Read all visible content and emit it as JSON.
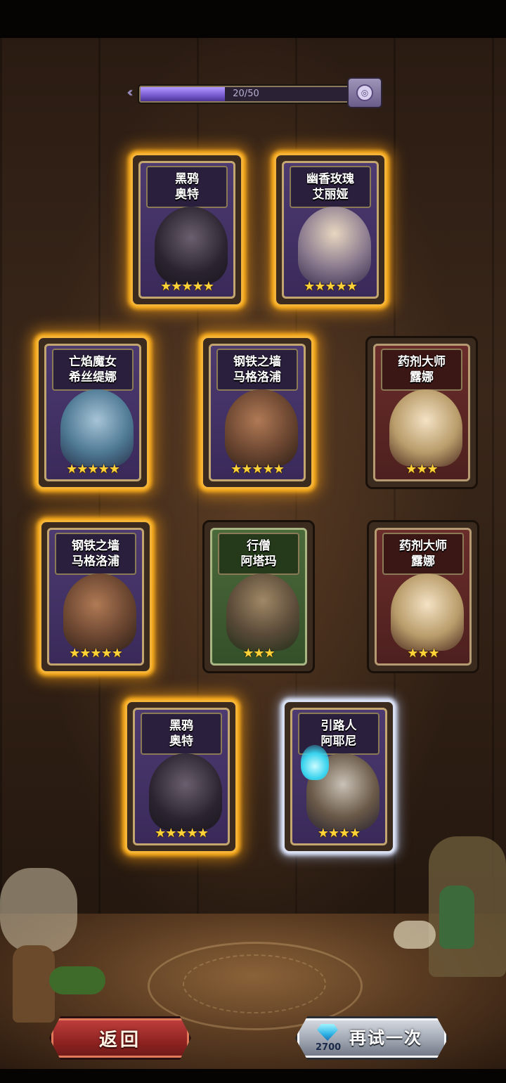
{
  "progress": {
    "text": "20/50",
    "current": 20,
    "total": 50
  },
  "cards": [
    {
      "name_line1": "黑鸦",
      "name_line2": "奥特",
      "stars": "★★★★★",
      "star_count": 5,
      "theme": "purple",
      "portrait": "plague-doctor-crow"
    },
    {
      "name_line1": "幽香玫瑰",
      "name_line2": "艾丽娅",
      "stars": "★★★★★",
      "star_count": 5,
      "theme": "purple",
      "portrait": "rose-knight"
    },
    {
      "name_line1": "亡焰魔女",
      "name_line2": "希丝缇娜",
      "stars": "★★★★★",
      "star_count": 5,
      "theme": "purple",
      "portrait": "flame-witch"
    },
    {
      "name_line1": "钢铁之墙",
      "name_line2": "马格洛浦",
      "stars": "★★★★★",
      "star_count": 5,
      "theme": "purple",
      "portrait": "steel-warrior"
    },
    {
      "name_line1": "药剂大师",
      "name_line2": "露娜",
      "stars": "★★★",
      "star_count": 3,
      "theme": "red",
      "portrait": "alchemist"
    },
    {
      "name_line1": "钢铁之墙",
      "name_line2": "马格洛浦",
      "stars": "★★★★★",
      "star_count": 5,
      "theme": "purple",
      "portrait": "steel-warrior"
    },
    {
      "name_line1": "行僧",
      "name_line2": "阿塔玛",
      "stars": "★★★",
      "star_count": 3,
      "theme": "green",
      "portrait": "wandering-monk"
    },
    {
      "name_line1": "药剂大师",
      "name_line2": "露娜",
      "stars": "★★★",
      "star_count": 3,
      "theme": "red",
      "portrait": "alchemist"
    },
    {
      "name_line1": "黑鸦",
      "name_line2": "奥特",
      "stars": "★★★★★",
      "star_count": 5,
      "theme": "purple",
      "portrait": "plague-doctor-crow"
    },
    {
      "name_line1": "引路人",
      "name_line2": "阿耶尼",
      "stars": "★★★★",
      "star_count": 4,
      "theme": "purple",
      "portrait": "guide-torch"
    }
  ],
  "buttons": {
    "back": "返回",
    "retry": "再试一次",
    "retry_cost": "2700"
  },
  "colors": {
    "gold_glow": "#ffb21e",
    "progress_fill": "#7b5fd4",
    "back_red": "#8e2321",
    "retry_silver": "#9aa1ad"
  }
}
